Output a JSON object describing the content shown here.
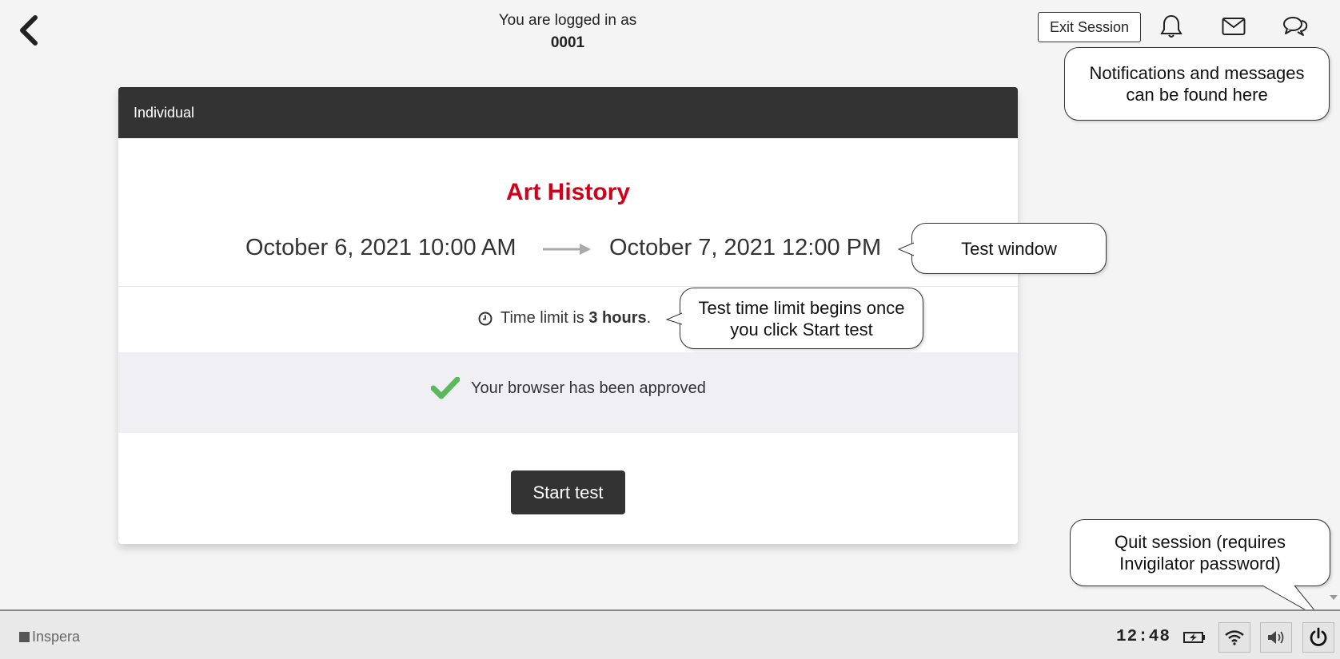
{
  "header": {
    "logged_in_label": "You are logged in as",
    "user_id": "0001",
    "exit_label": "Exit Session"
  },
  "card": {
    "header_label": "Individual",
    "title": "Art History",
    "start_date": "October 6, 2021 10:00 AM",
    "end_date": "October 7, 2021 12:00 PM",
    "time_limit_prefix": "Time limit is",
    "time_limit_value": "3 hours",
    "time_limit_suffix": ".",
    "browser_status": "Your browser has been approved",
    "start_label": "Start test"
  },
  "callouts": {
    "notifications": "Notifications and messages can be found here",
    "test_window": "Test window",
    "time_limit": "Test time limit begins once you click Start test",
    "quit": "Quit session (requires Invigilator password)"
  },
  "taskbar": {
    "brand": "Inspera",
    "time": "12:48"
  },
  "colors": {
    "title_red": "#d0021b",
    "header_dark": "#333333",
    "check_green": "#5cb85c",
    "approved_bg": "#efeff4"
  },
  "icons": {
    "back": "chevron-left-icon",
    "notifications": "bell-icon",
    "messages": "envelope-icon",
    "chat": "chat-bubbles-icon",
    "clock": "clock-icon",
    "check": "checkmark-icon",
    "battery": "battery-charging-icon",
    "wifi": "wifi-icon",
    "volume": "speaker-icon",
    "power": "power-icon"
  }
}
